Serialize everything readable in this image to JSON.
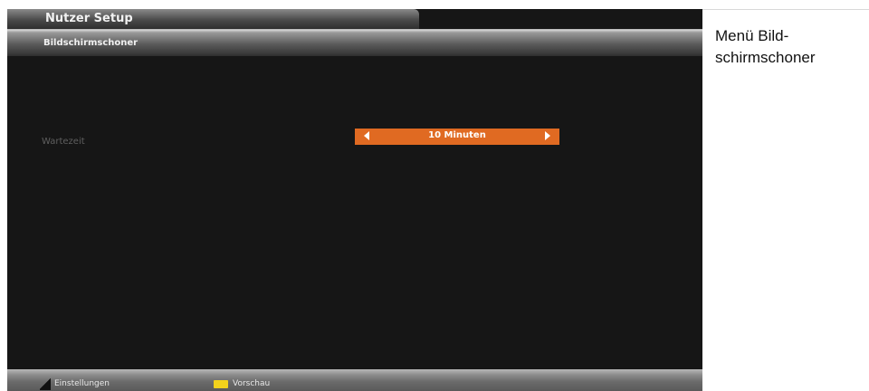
{
  "window": {
    "title": "Nutzer Setup"
  },
  "menu": {
    "title": "Bildschirmschoner",
    "setting_label": "Wartezeit",
    "setting_value": "10 Minuten"
  },
  "footer": {
    "settings_label": "Einstellungen",
    "preview_label": "Vorschau"
  },
  "caption": {
    "line1": "Menü Bild-",
    "line2": "schirmschoner"
  },
  "icons": {
    "left": "chevron-left-icon",
    "right": "chevron-right-icon",
    "settings_key": "settings-key-icon",
    "preview_key": "yellow-key-icon"
  },
  "colors": {
    "selector": "#e06a22",
    "yellow_key": "#f2d21c",
    "screen_bg": "#161616"
  }
}
